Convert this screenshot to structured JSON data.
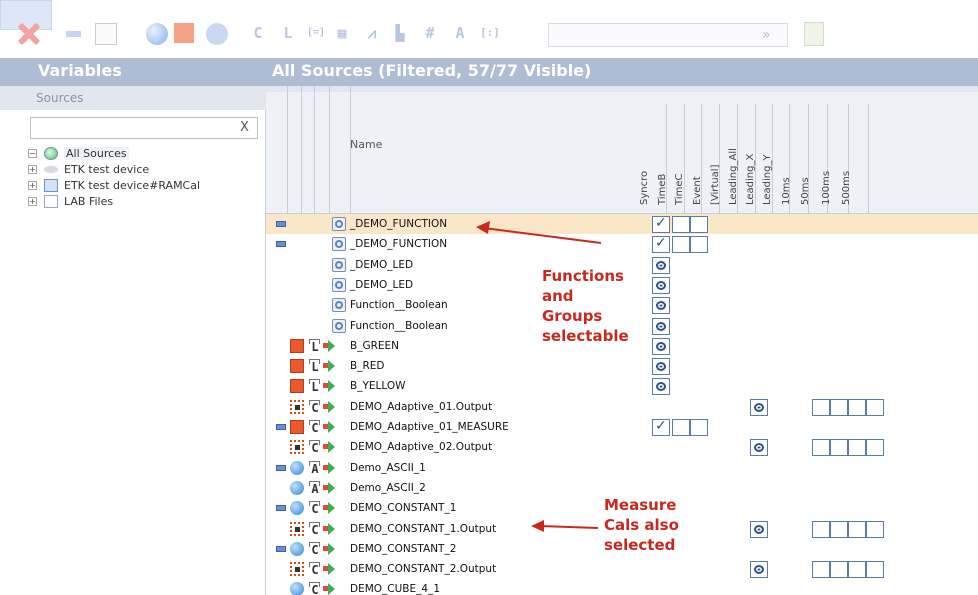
{
  "toolbar": {
    "items": [
      "delete-icon",
      "collapse-icon",
      "blank-box-icon",
      "sphere-icon",
      "square-icon",
      "wave-icon",
      "constant-icon",
      "lookup-icon",
      "range-icon",
      "grid-icon",
      "line-chart-icon",
      "bar-chart-icon",
      "hash-icon",
      "ascii-icon",
      "matrix-icon",
      "chevron-down-icon",
      "edit-note-icon"
    ],
    "combo_value": ""
  },
  "left_panel": {
    "title": "Variables",
    "sources_label": "Sources",
    "search": {
      "value": "",
      "placeholder": ""
    },
    "clear_label": "X",
    "tree": [
      {
        "label": "All Sources",
        "expander": "−",
        "icon": "globe-icon"
      },
      {
        "label": "ETK test device",
        "expander": "+",
        "icon": "device-icon"
      },
      {
        "label": "ETK test device#RAMCal",
        "expander": "+",
        "icon": "ram-icon"
      },
      {
        "label": "LAB Files",
        "expander": "+",
        "icon": "file-icon"
      }
    ]
  },
  "grid": {
    "title": "All Sources (Filtered, 57/77 Visible)",
    "name_header": "Name",
    "columns": [
      "Syncro",
      "TimeB",
      "TimeC",
      "Event",
      "[Virtual]",
      "Leading_All",
      "Leading_X",
      "Leading_Y",
      "10ms",
      "50ms",
      "100ms",
      "500ms"
    ],
    "rows": [
      {
        "name": "_DEMO_FUNCTION",
        "selected": true,
        "marker": true,
        "kind": "function",
        "syncro": "check",
        "tc": [
          "empty",
          "empty"
        ]
      },
      {
        "name": "_DEMO_FUNCTION",
        "selected": false,
        "marker": true,
        "kind": "function",
        "syncro": "check",
        "tc": [
          "empty",
          "empty"
        ]
      },
      {
        "name": "_DEMO_LED",
        "kind": "function",
        "syncro": "dot"
      },
      {
        "name": "_DEMO_LED",
        "kind": "function",
        "syncro": "dot"
      },
      {
        "name": "Function__Boolean",
        "kind": "function",
        "syncro": "dot"
      },
      {
        "name": "Function__Boolean",
        "kind": "function",
        "syncro": "dot"
      },
      {
        "name": "B_GREEN",
        "kind": "red-l",
        "type": "L",
        "syncro": "dot"
      },
      {
        "name": "B_RED",
        "kind": "red-l",
        "type": "L",
        "syncro": "dot"
      },
      {
        "name": "B_YELLOW",
        "kind": "red-l",
        "type": "L",
        "syncro": "dot"
      },
      {
        "name": "DEMO_Adaptive_01.Output",
        "kind": "chip",
        "type": "C",
        "leading": "dot",
        "rates": 4
      },
      {
        "name": "DEMO_Adaptive_01_MEASURE",
        "marker": true,
        "kind": "red-l",
        "type": "C",
        "syncro": "check",
        "tc": [
          "empty",
          "empty"
        ]
      },
      {
        "name": "DEMO_Adaptive_02.Output",
        "kind": "chip",
        "type": "C",
        "leading": "dot",
        "rates": 4
      },
      {
        "name": "Demo_ASCII_1",
        "marker": true,
        "kind": "ball",
        "type": "A"
      },
      {
        "name": "Demo_ASCII_2",
        "kind": "ball",
        "type": "A"
      },
      {
        "name": "DEMO_CONSTANT_1",
        "marker": true,
        "kind": "ball",
        "type": "C"
      },
      {
        "name": "DEMO_CONSTANT_1.Output",
        "kind": "chip",
        "type": "C",
        "leading": "dot",
        "rates": 4
      },
      {
        "name": "DEMO_CONSTANT_2",
        "marker": true,
        "kind": "ball",
        "type": "C"
      },
      {
        "name": "DEMO_CONSTANT_2.Output",
        "kind": "chip",
        "type": "C",
        "leading": "dot",
        "rates": 4
      },
      {
        "name": "DEMO_CUBE_4_1",
        "kind": "ball",
        "type": "C"
      }
    ]
  },
  "annotations": [
    {
      "text": "Functions and Groups selectable",
      "lines": [
        "Functions",
        "and",
        "Groups",
        "selectable"
      ],
      "color": "#c8281e"
    },
    {
      "text": "Measure Cals also selected",
      "lines": [
        "Measure",
        "Cals also",
        "selected"
      ],
      "color": "#c8281e"
    }
  ]
}
